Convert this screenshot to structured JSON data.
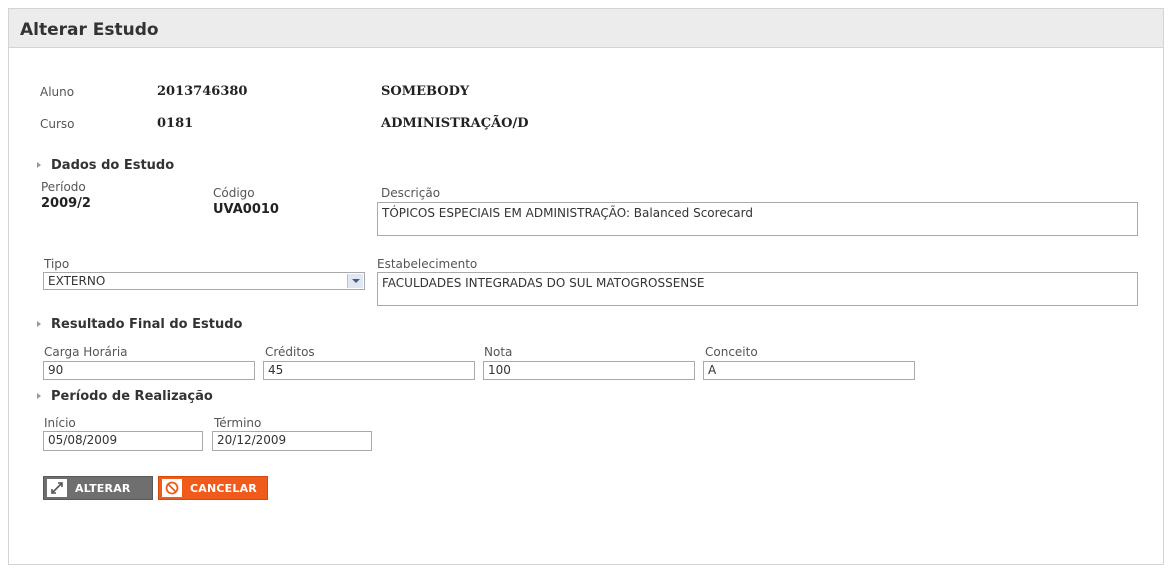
{
  "page": {
    "title": "Alterar Estudo"
  },
  "aluno": {
    "label": "Aluno",
    "codigo": "2013746380",
    "nome": "SOMEBODY"
  },
  "curso": {
    "label": "Curso",
    "codigo": "0181",
    "nome": "ADMINISTRAÇÃO/D"
  },
  "dados_estudo": {
    "heading": "Dados do Estudo",
    "periodo_label": "Período",
    "periodo_value": "2009/2",
    "codigo_label": "Código",
    "codigo_value": "UVA0010",
    "descricao_label": "Descrição",
    "descricao_value": "TÓPICOS ESPECIAIS EM ADMINISTRAÇÃO: Balanced Scorecard",
    "tipo_label": "Tipo",
    "tipo_value": "EXTERNO",
    "estabelecimento_label": "Estabelecimento",
    "estabelecimento_value": "FACULDADES INTEGRADAS DO SUL MATOGROSSENSE"
  },
  "resultado_final": {
    "heading": "Resultado Final do Estudo",
    "carga_label": "Carga Horária",
    "carga_value": "90",
    "creditos_label": "Créditos",
    "creditos_value": "45",
    "nota_label": "Nota",
    "nota_value": "100",
    "conceito_label": "Conceito",
    "conceito_value": "A"
  },
  "periodo_realizacao": {
    "heading": "Período de Realização",
    "inicio_label": "Início",
    "inicio_value": "05/08/2009",
    "termino_label": "Término",
    "termino_value": "20/12/2009"
  },
  "actions": {
    "alterar_label": "ALTERAR",
    "cancelar_label": "CANCELAR",
    "alterar_icon": "expand-arrows-icon",
    "cancelar_icon": "cancel-circle-icon"
  },
  "colors": {
    "cancel": "#f05a1a",
    "alterar": "#6f6f6f",
    "titlebar": "#ececec"
  }
}
